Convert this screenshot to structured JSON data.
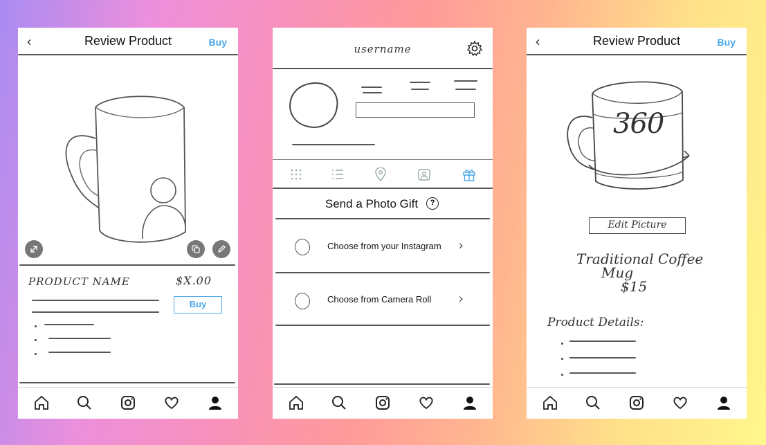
{
  "screens": [
    {
      "header": {
        "back_icon": "chevron-left-icon",
        "title": "Review Product",
        "buy_label": "Buy"
      },
      "product": {
        "name": "PRODUCT NAME",
        "price": "$X.00",
        "buy_button": "Buy"
      },
      "icons": [
        "expand-icon",
        "copy-icon",
        "edit-icon"
      ]
    },
    {
      "header": {
        "username": "username",
        "settings_icon": "gear-icon"
      },
      "tabs": [
        "grid-icon",
        "list-icon",
        "location-pin-icon",
        "tagged-person-icon",
        "gift-icon"
      ],
      "gift_section": {
        "title": "Send a Photo Gift",
        "help_symbol": "?",
        "options": [
          "Choose from your Instagram",
          "Choose from Camera Roll"
        ]
      }
    },
    {
      "header": {
        "back_icon": "chevron-left-icon",
        "title": "Review Product",
        "buy_label": "Buy"
      },
      "product": {
        "view_label": "360",
        "edit_picture": "Edit Picture",
        "name_line1": "Traditional Coffee",
        "name_line2": "Mug",
        "price": "$15",
        "details_label": "Product Details:"
      }
    }
  ],
  "bottom_nav": [
    "home-icon",
    "search-icon",
    "instagram-icon",
    "heart-icon",
    "profile-icon"
  ],
  "colors": {
    "accent": "#4aa8e8",
    "sketch": "#444444",
    "screen_bg": "#ffffff"
  }
}
